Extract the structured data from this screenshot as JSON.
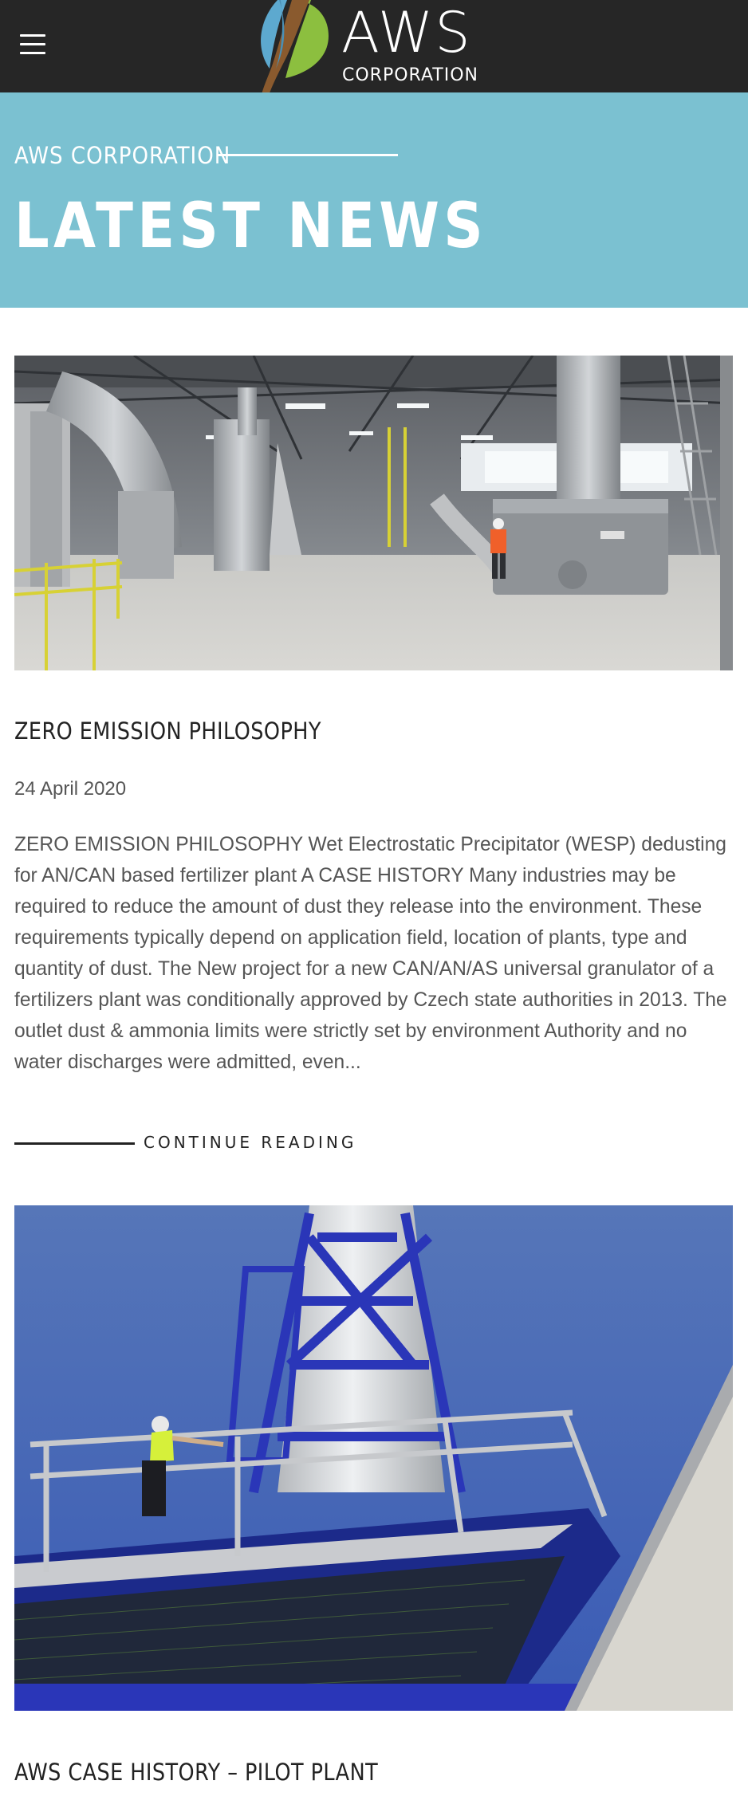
{
  "header": {
    "menu_icon": "hamburger-menu-icon",
    "logo": {
      "word": "AWS",
      "sub": "CORPORATION"
    },
    "colors": {
      "bar": "#262626",
      "leaf_blue": "#5da9cf",
      "leaf_green": "#8cbf3f",
      "leaf_brown": "#8a5a2e"
    }
  },
  "hero": {
    "eyebrow": "AWS CORPORATION",
    "title": "LATEST NEWS",
    "background": "#7bc1d1"
  },
  "posts": [
    {
      "image": "industrial-plant-interior-photo",
      "title": "ZERO EMISSION PHILOSOPHY",
      "date": "24 April 2020",
      "excerpt": "ZERO EMISSION PHILOSOPHY Wet Electrostatic Precipitator (WESP) dedusting for AN/CAN based fertilizer plant A CASE HISTORY Many industries may be required to reduce the amount of dust they release into the environment.  These requirements typically depend on application field, location of plants, type and quantity of dust. The New project for a new CAN/AN/AS universal granulator of a fertilizers plant was conditionally approved by Czech state authorities in 2013. The outlet dust & ammonia limits were strictly set by environment Authority and no water discharges were admitted, even...",
      "cta": "CONTINUE READING"
    },
    {
      "image": "pilot-plant-stack-platform-photo",
      "title": "AWS CASE HISTORY – PILOT PLANT"
    }
  ]
}
